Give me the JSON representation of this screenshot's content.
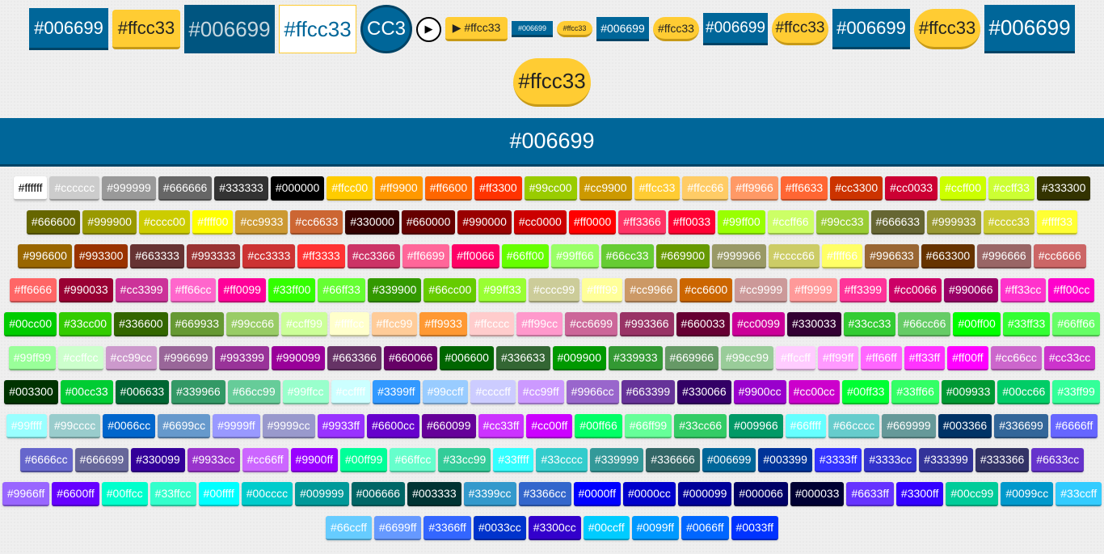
{
  "top_buttons": [
    {
      "label": "#006699",
      "style": "s-blue",
      "w": 98,
      "h": 52,
      "fs": 22
    },
    {
      "label": "#ffcc33",
      "style": "s-yellow s-r",
      "w": 84,
      "h": 49,
      "fs": 22
    },
    {
      "label": "#006699",
      "style": "s-darkfaded",
      "w": 112,
      "h": 60,
      "fs": 26
    },
    {
      "label": "#ffcc33",
      "style": "s-outline",
      "w": 96,
      "h": 60,
      "fs": 26
    },
    {
      "label": "CC3",
      "style": "s-circle",
      "w": 64,
      "h": 60,
      "fs": 24
    },
    {
      "label": "▶",
      "style": "s-play",
      "w": 31,
      "h": 31,
      "fs": 13
    },
    {
      "label": "▶ #ffcc33",
      "style": "s-yellow s-r",
      "w": 77,
      "h": 30,
      "fs": 14
    },
    {
      "label": "#006699",
      "style": "s-blue",
      "w": 51,
      "h": 20,
      "fs": 9
    },
    {
      "label": "#ffcc33",
      "style": "s-yellow s-pill",
      "w": 44,
      "h": 20,
      "fs": 9
    },
    {
      "label": "#006699",
      "style": "s-blue",
      "w": 65,
      "h": 30,
      "fs": 14
    },
    {
      "label": "#ffcc33",
      "style": "s-yellow s-pill",
      "w": 57,
      "h": 30,
      "fs": 14
    },
    {
      "label": "#006699",
      "style": "s-blue",
      "w": 80,
      "h": 40,
      "fs": 19
    },
    {
      "label": "#ffcc33",
      "style": "s-yellow s-pill",
      "w": 70,
      "h": 40,
      "fs": 19
    },
    {
      "label": "#006699",
      "style": "s-blue",
      "w": 96,
      "h": 50,
      "fs": 22
    },
    {
      "label": "#ffcc33",
      "style": "s-yellow s-pill",
      "w": 82,
      "h": 50,
      "fs": 22
    },
    {
      "label": "#006699",
      "style": "s-blue",
      "w": 112,
      "h": 60,
      "fs": 26
    },
    {
      "label": "#ffcc33",
      "style": "s-yellow s-pill",
      "w": 96,
      "h": 60,
      "fs": 26
    }
  ],
  "banner_label": "#006699",
  "swatches": [
    "#ffffff",
    "#cccccc",
    "#999999",
    "#666666",
    "#333333",
    "#000000",
    "#ffcc00",
    "#ff9900",
    "#ff6600",
    "#ff3300",
    "#99cc00",
    "#cc9900",
    "#ffcc33",
    "#ffcc66",
    "#ff9966",
    "#ff6633",
    "#cc3300",
    "#cc0033",
    "#ccff00",
    "#ccff33",
    "#333300",
    "#666600",
    "#999900",
    "#cccc00",
    "#ffff00",
    "#cc9933",
    "#cc6633",
    "#330000",
    "#660000",
    "#990000",
    "#cc0000",
    "#ff0000",
    "#ff3366",
    "#ff0033",
    "#99ff00",
    "#ccff66",
    "#99cc33",
    "#666633",
    "#999933",
    "#cccc33",
    "#ffff33",
    "#996600",
    "#993300",
    "#663333",
    "#993333",
    "#cc3333",
    "#ff3333",
    "#cc3366",
    "#ff6699",
    "#ff0066",
    "#66ff00",
    "#99ff66",
    "#66cc33",
    "#669900",
    "#999966",
    "#cccc66",
    "#ffff66",
    "#996633",
    "#663300",
    "#996666",
    "#cc6666",
    "#ff6666",
    "#990033",
    "#cc3399",
    "#ff66cc",
    "#ff0099",
    "#33ff00",
    "#66ff33",
    "#339900",
    "#66cc00",
    "#99ff33",
    "#cccc99",
    "#ffff99",
    "#cc9966",
    "#cc6600",
    "#cc9999",
    "#ff9999",
    "#ff3399",
    "#cc0066",
    "#990066",
    "#ff33cc",
    "#ff00cc",
    "#00cc00",
    "#33cc00",
    "#336600",
    "#669933",
    "#99cc66",
    "#ccff99",
    "#ffffcc",
    "#ffcc99",
    "#ff9933",
    "#ffcccc",
    "#ff99cc",
    "#cc6699",
    "#993366",
    "#660033",
    "#cc0099",
    "#330033",
    "#33cc33",
    "#66cc66",
    "#00ff00",
    "#33ff33",
    "#66ff66",
    "#99ff99",
    "#ccffcc",
    "#cc99cc",
    "#996699",
    "#993399",
    "#990099",
    "#663366",
    "#660066",
    "#006600",
    "#336633",
    "#009900",
    "#339933",
    "#669966",
    "#99cc99",
    "#ffccff",
    "#ff99ff",
    "#ff66ff",
    "#ff33ff",
    "#ff00ff",
    "#cc66cc",
    "#cc33cc",
    "#003300",
    "#00cc33",
    "#006633",
    "#339966",
    "#66cc99",
    "#99ffcc",
    "#ccffff",
    "#3399ff",
    "#99ccff",
    "#ccccff",
    "#cc99ff",
    "#9966cc",
    "#663399",
    "#330066",
    "#9900cc",
    "#cc00cc",
    "#00ff33",
    "#33ff66",
    "#009933",
    "#00cc66",
    "#33ff99",
    "#99ffff",
    "#99cccc",
    "#0066cc",
    "#6699cc",
    "#9999ff",
    "#9999cc",
    "#9933ff",
    "#6600cc",
    "#660099",
    "#cc33ff",
    "#cc00ff",
    "#00ff66",
    "#66ff99",
    "#33cc66",
    "#009966",
    "#66ffff",
    "#66cccc",
    "#669999",
    "#003366",
    "#336699",
    "#6666ff",
    "#6666cc",
    "#666699",
    "#330099",
    "#9933cc",
    "#cc66ff",
    "#9900ff",
    "#00ff99",
    "#66ffcc",
    "#33cc99",
    "#33ffff",
    "#33cccc",
    "#339999",
    "#336666",
    "#006699",
    "#003399",
    "#3333ff",
    "#3333cc",
    "#333399",
    "#333366",
    "#6633cc",
    "#9966ff",
    "#6600ff",
    "#00ffcc",
    "#33ffcc",
    "#00ffff",
    "#00cccc",
    "#009999",
    "#006666",
    "#003333",
    "#3399cc",
    "#3366cc",
    "#0000ff",
    "#0000cc",
    "#000099",
    "#000066",
    "#000033",
    "#6633ff",
    "#3300ff",
    "#00cc99",
    "#0099cc",
    "#33ccff",
    "#66ccff",
    "#6699ff",
    "#3366ff",
    "#0033cc",
    "#3300cc",
    "#00ccff",
    "#0099ff",
    "#0066ff",
    "#0033ff"
  ]
}
